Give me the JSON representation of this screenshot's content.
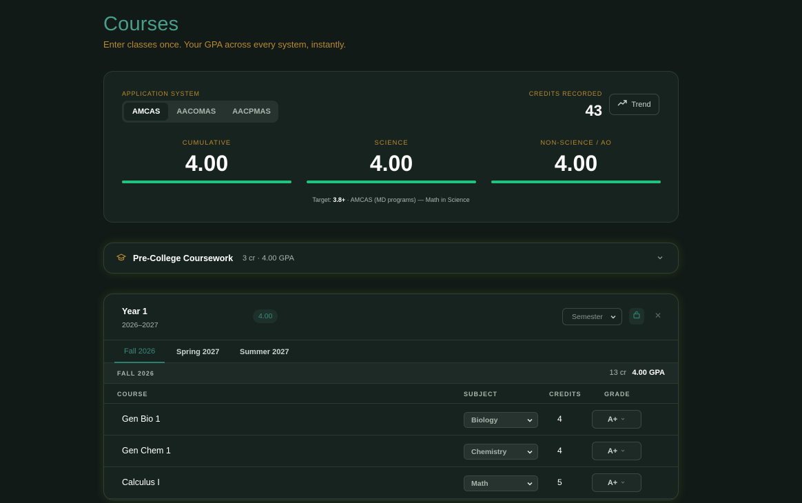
{
  "page": {
    "title": "Courses",
    "subtitle": "Enter classes once. Your GPA across every system, instantly."
  },
  "summary": {
    "system_label": "APPLICATION SYSTEM",
    "systems": [
      "AMCAS",
      "AACOMAS",
      "AACPMAS"
    ],
    "active_system": "AMCAS",
    "credits_label": "CREDITS RECORDED",
    "credits_value": "43",
    "trend_label": "Trend",
    "gpas": [
      {
        "label": "CUMULATIVE",
        "value": "4.00",
        "fill": 1.0
      },
      {
        "label": "SCIENCE",
        "value": "4.00",
        "fill": 1.0
      },
      {
        "label": "NON-SCIENCE / AO",
        "value": "4.00",
        "fill": 1.0
      }
    ],
    "target_prefix": "Target:",
    "target_value": "3.8+",
    "target_suffix": "· AMCAS (MD programs) — Math in Science",
    "bar_color": "#20c47f"
  },
  "precollege": {
    "icon": "graduation-cap-icon",
    "title": "Pre-College Coursework",
    "meta": "3 cr · 4.00 GPA"
  },
  "year": {
    "title": "Year 1",
    "range": "2026–2027",
    "gpa_pill": "4.00",
    "term_type": "Semester",
    "tabs": [
      "Fall 2026",
      "Spring 2027",
      "Summer 2027"
    ],
    "active_tab": "Fall 2026",
    "term": {
      "name": "FALL 2026",
      "credits": "13 cr",
      "gpa": "4.00 GPA"
    },
    "columns": [
      "COURSE",
      "SUBJECT",
      "CREDITS",
      "GRADE"
    ],
    "courses": [
      {
        "name": "Gen Bio 1",
        "subject": "Biology",
        "credits": "4",
        "grade": "A+"
      },
      {
        "name": "Gen Chem 1",
        "subject": "Chemistry",
        "credits": "4",
        "grade": "A+"
      },
      {
        "name": "Calculus I",
        "subject": "Math",
        "credits": "5",
        "grade": "A+"
      }
    ]
  }
}
